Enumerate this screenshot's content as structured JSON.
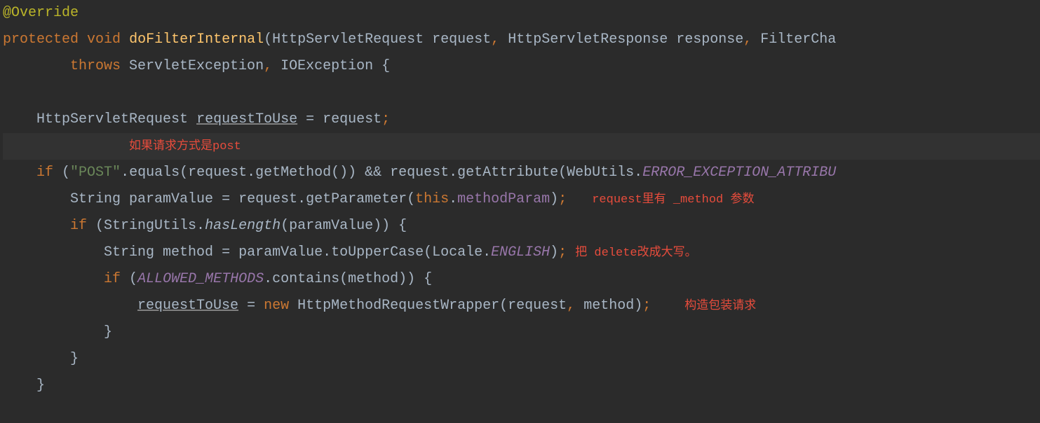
{
  "code": {
    "l1_annotation": "@Override",
    "l2_protected": "protected",
    "l2_void": "void",
    "l2_method": "doFilterInternal",
    "l2_params": "(HttpServletRequest request",
    "l2_c1": ",",
    "l2_p2": " HttpServletResponse response",
    "l2_c2": ",",
    "l2_p3": " FilterCha",
    "l3_throws": "throws",
    "l3_ex": " ServletException",
    "l3_c1": ",",
    "l3_ioe": " IOException {",
    "l5_type": "HttpServletRequest ",
    "l5_var": "requestToUse",
    "l5_assign": " = request",
    "l5_semi": ";",
    "l6_comment": "如果请求方式是post",
    "l7_if": "if",
    "l7_open": " (",
    "l7_str": "\"POST\"",
    "l7_eq": ".equals(request.getMethod()) && request.getAttribute(WebUtils.",
    "l7_const": "ERROR_EXCEPTION_ATTRIBU",
    "l8_type": "String ",
    "l8_var": "paramValue",
    "l8_assign": " = request.getParameter(",
    "l8_this": "this",
    "l8_dot": ".",
    "l8_field": "methodParam",
    "l8_close": ")",
    "l8_semi": ";",
    "l8_comment": "request里有 _method 参数",
    "l9_if": "if",
    "l9_open": " (StringUtils.",
    "l9_hasLength": "hasLength",
    "l9_close": "(paramValue)) {",
    "l10_type": "String ",
    "l10_var": "method",
    "l10_assign": " = paramValue.toUpperCase(Locale.",
    "l10_english": "ENGLISH",
    "l10_close": ")",
    "l10_semi": ";",
    "l10_comment": "把 delete改成大写。",
    "l11_if": "if",
    "l11_open": " (",
    "l11_allowed": "ALLOWED_METHODS",
    "l11_contains": ".contains(method)) {",
    "l12_var": "requestToUse",
    "l12_eq": " = ",
    "l12_new": "new",
    "l12_rest": " HttpMethodRequestWrapper(request",
    "l12_c1": ",",
    "l12_m": " method)",
    "l12_semi": ";",
    "l12_comment": "构造包装请求",
    "l13_brace": "}",
    "l14_brace": "}",
    "l15_brace": "}"
  }
}
